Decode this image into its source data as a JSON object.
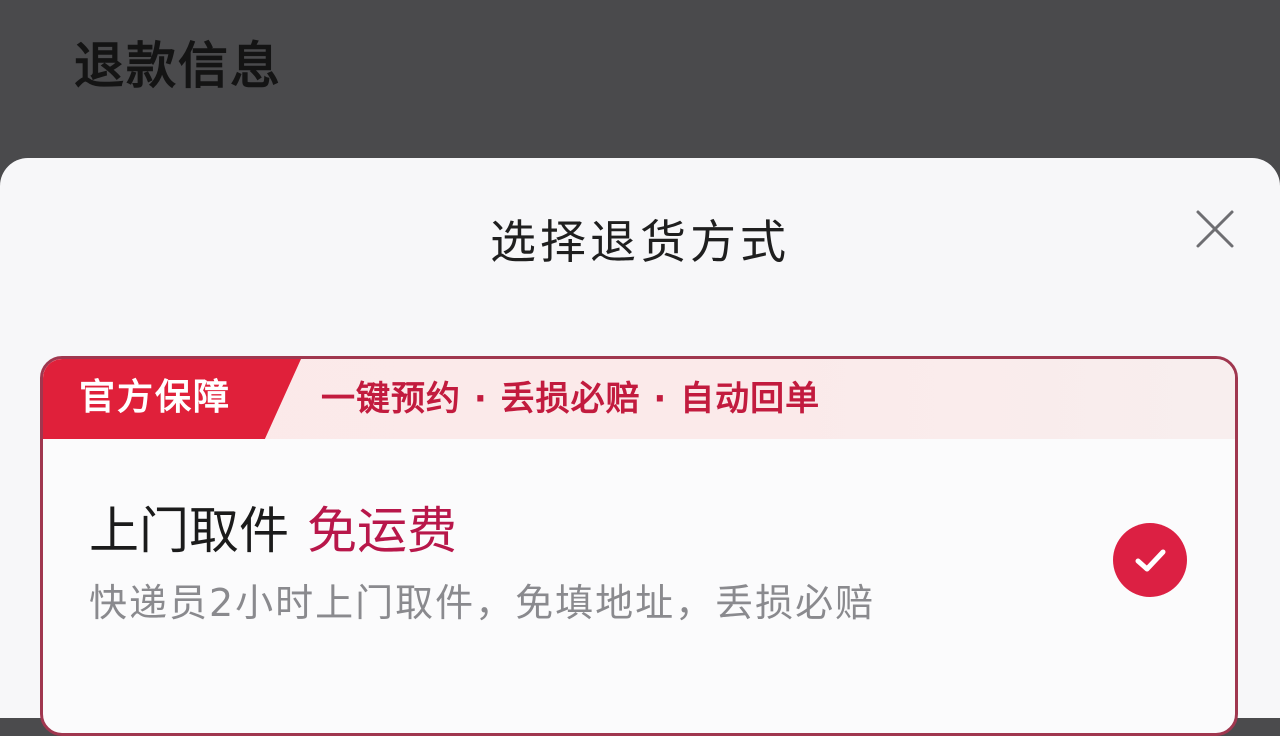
{
  "background": {
    "title": "退款信息"
  },
  "sheet": {
    "title": "选择退货方式",
    "close_icon": "close-icon"
  },
  "option": {
    "badge": "官方保障",
    "features": "一键预约 · 丢损必赔 · 自动回单",
    "title": "上门取件",
    "highlight": "免运费",
    "description": "快递员2小时上门取件，免填地址，丢损必赔",
    "selected": true,
    "check_icon": "check-icon"
  },
  "colors": {
    "accent": "#dc2043",
    "border": "#a0374f",
    "highlight": "#b8174a",
    "dim_overlay": "#4a4a4c"
  }
}
